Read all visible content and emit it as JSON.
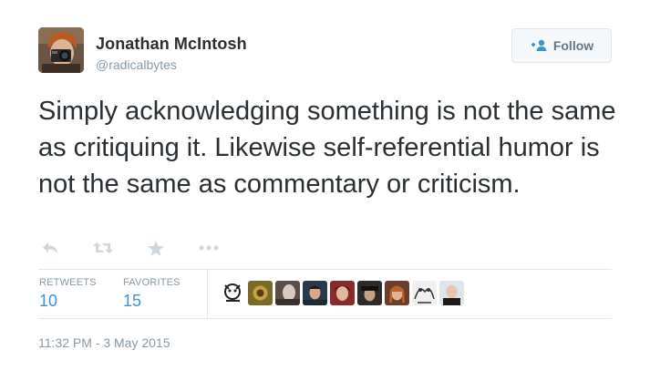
{
  "author": {
    "name": "Jonathan McIntosh",
    "handle": "@radicalbytes"
  },
  "follow_button": {
    "label": "Follow",
    "icon": "add-person-icon"
  },
  "tweet": {
    "text": "Simply acknowledging something is not the same as critiquing it. Likewise self-referential humor is not the same as commentary or criticism."
  },
  "actions": [
    {
      "name": "reply-icon"
    },
    {
      "name": "retweet-icon"
    },
    {
      "name": "favorite-star-icon"
    },
    {
      "name": "more-dots-icon"
    }
  ],
  "stats": {
    "retweets_label": "RETWEETS",
    "retweets_count": "10",
    "favorites_label": "FAVORITES",
    "favorites_count": "15"
  },
  "favoriter_avatar_count": 9,
  "timestamp": "11:32 PM - 3 May 2015",
  "colors": {
    "text": "#292f33",
    "muted": "#8899a6",
    "link": "#3b94d9",
    "border": "#e1e8ed",
    "icon": "#ccd6dd"
  }
}
